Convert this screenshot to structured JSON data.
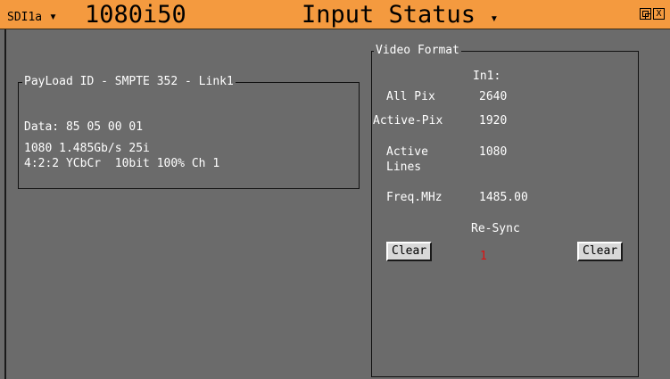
{
  "header": {
    "source": "SDI1a",
    "format": "1080i50",
    "title": "Input Status",
    "restore_icon": "restore-icon",
    "close_glyph": "X"
  },
  "payload": {
    "legend": "PayLoad ID - SMPTE 352 - Link1",
    "data": "Data: 85 05 00 01",
    "line1": "1080 1.485Gb/s 25i",
    "line2": "4:2:2 YCbCr  10bit 100% Ch 1"
  },
  "video": {
    "legend": "Video Format",
    "column": "In1:",
    "rows": [
      {
        "label": "All Pix",
        "value": "2640"
      },
      {
        "label": "Active-Pix",
        "value": "1920"
      },
      {
        "label": "Active",
        "label2": "Lines",
        "value": "1080"
      },
      {
        "label": "Freq.MHz",
        "value": "1485.00"
      }
    ],
    "resync_label": "Re-Sync",
    "resync_value": "1",
    "clear_left": "Clear",
    "clear_right": "Clear"
  },
  "colors": {
    "titlebar": "#f49a3f",
    "background": "#6b6b6b",
    "alert": "#e01010"
  }
}
